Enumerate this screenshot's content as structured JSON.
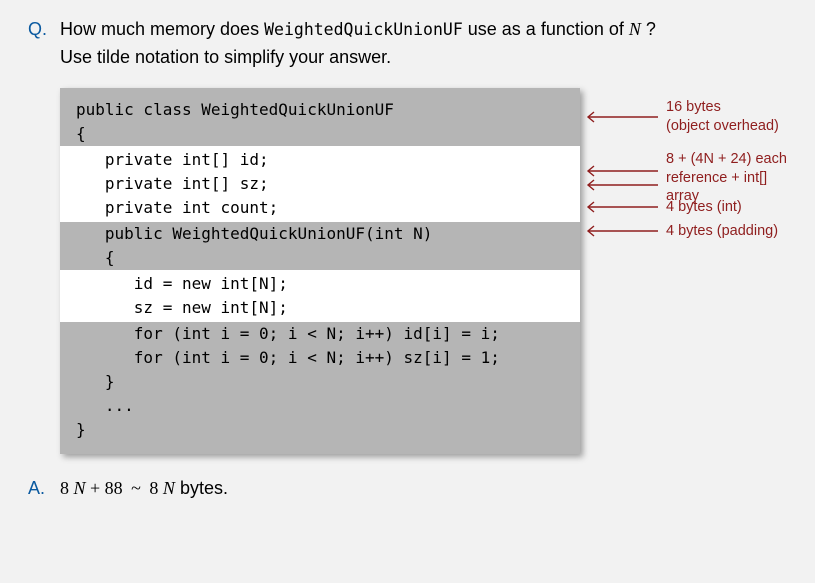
{
  "question": {
    "marker": "Q.",
    "line1_pre": "How much memory does ",
    "line1_code": "WeightedQuickUnionUF",
    "line1_mid": " use as a function of ",
    "line1_var": "N",
    "line1_post": " ?",
    "line2": "Use tilde notation to simplify your answer."
  },
  "code": {
    "lines": [
      {
        "text": "public class WeightedQuickUnionUF",
        "hl": false
      },
      {
        "text": "{",
        "hl": false
      },
      {
        "text": "   private int[] id;",
        "hl": true
      },
      {
        "text": "   private int[] sz;",
        "hl": true
      },
      {
        "text": "   private int count;",
        "hl": true
      },
      {
        "text": "",
        "hl": false
      },
      {
        "text": "   public WeightedQuickUnionUF(int N)",
        "hl": false
      },
      {
        "text": "   {",
        "hl": false
      },
      {
        "text": "      id = new int[N];",
        "hl": true
      },
      {
        "text": "      sz = new int[N];",
        "hl": true
      },
      {
        "text": "      for (int i = 0; i < N; i++) id[i] = i;",
        "hl": false
      },
      {
        "text": "      for (int i = 0; i < N; i++) sz[i] = 1;",
        "hl": false
      },
      {
        "text": "   }",
        "hl": false
      },
      {
        "text": "   ...",
        "hl": false
      },
      {
        "text": "}",
        "hl": false
      }
    ]
  },
  "annotations": {
    "a1_l1": "16 bytes",
    "a1_l2": "(object overhead)",
    "a2_l1": "8 + (4N + 24) each",
    "a2_l2": "reference + int[] array",
    "a3": "4 bytes (int)",
    "a4": "4 bytes (padding)"
  },
  "answer": {
    "marker": "A.",
    "lhs_coeff": "8",
    "lhs_var": "N",
    "plus": " + ",
    "const": "88",
    "tilde": "~",
    "rhs_coeff": "8",
    "rhs_var": "N",
    "unit": " bytes."
  }
}
